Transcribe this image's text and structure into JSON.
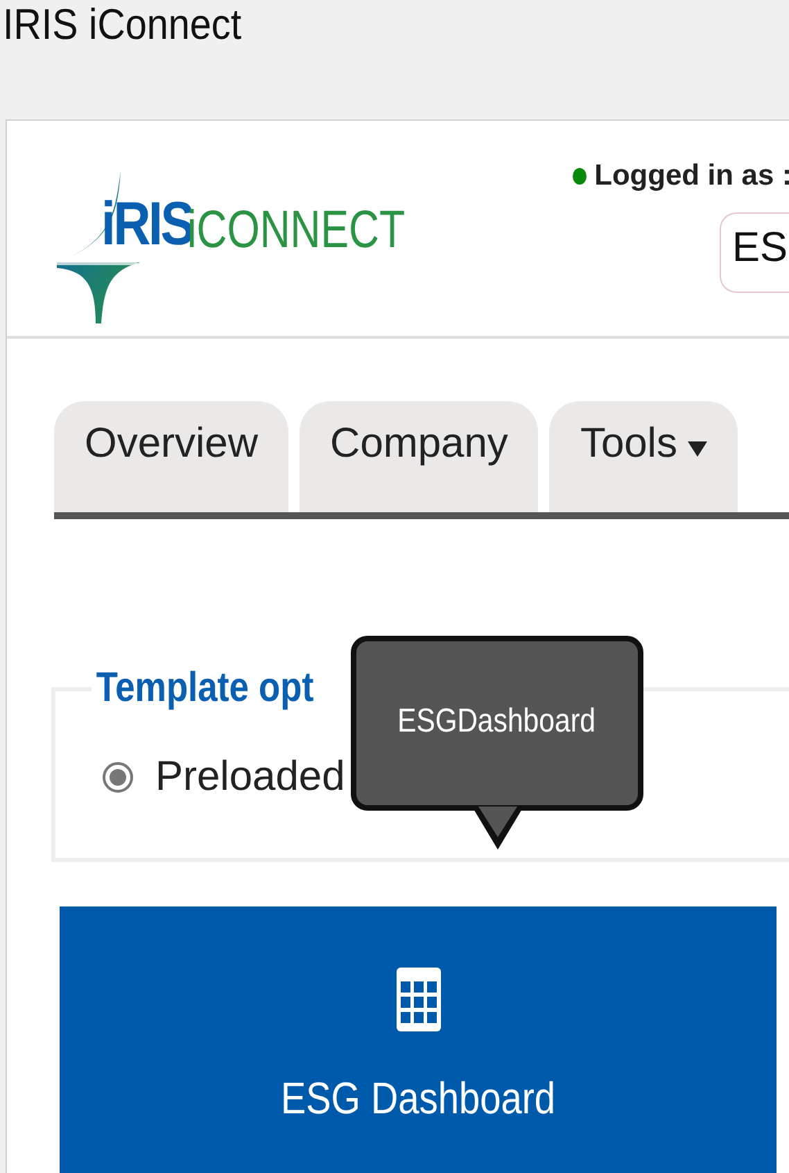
{
  "window": {
    "title": "IRIS iConnect"
  },
  "header": {
    "logo": {
      "brand": "iRIS",
      "product": "iCONNECT"
    },
    "status": {
      "online": true,
      "label": "Logged in as :"
    },
    "account_field": {
      "value": "ES"
    }
  },
  "tabs": [
    {
      "label": "Overview",
      "kind": "plain"
    },
    {
      "label": "Company",
      "kind": "plain"
    },
    {
      "label": "Tools",
      "kind": "dropdown"
    }
  ],
  "template_options": {
    "legend": "Template opt",
    "options": [
      {
        "label": "Preloaded",
        "checked": true
      }
    ]
  },
  "tooltip": {
    "text": "ESGDashboard"
  },
  "tiles": [
    {
      "label": "ESG Dashboard",
      "kind": "grid"
    }
  ]
}
